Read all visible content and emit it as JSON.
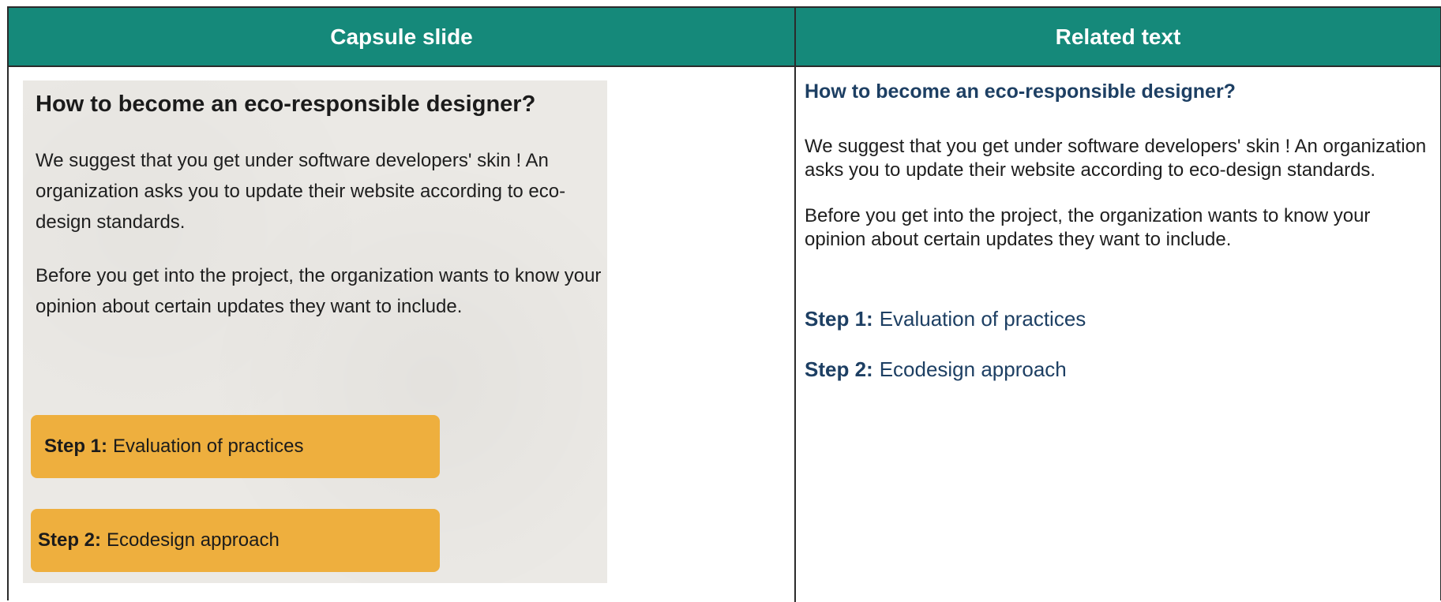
{
  "header": {
    "left_label": "Capsule slide",
    "right_label": "Related text"
  },
  "slide": {
    "title": "How to become an eco-responsible designer?",
    "paragraph1": "We suggest that you get under software developers' skin ! An organization asks you to update their website according to eco-design standards.",
    "paragraph2": "Before you get into the project, the organization wants to know your opinion about certain updates they want to include.",
    "steps": [
      {
        "label": "Step 1:",
        "text": "Evaluation of practices"
      },
      {
        "label": "Step 2:",
        "text": "Ecodesign approach"
      }
    ],
    "colors": {
      "background": "#ebe9e5",
      "step_box": "#eeaf3e"
    }
  },
  "related": {
    "title": "How to become an eco-responsible designer?",
    "paragraph1": "We suggest that you get under software developers' skin ! An organization asks you to update their website according to eco-design standards.",
    "paragraph2": "Before you get into the project, the organization wants to know your opinion about certain updates they want to include.",
    "steps": [
      {
        "label": "Step 1:",
        "text": "Evaluation of practices"
      },
      {
        "label": "Step 2:",
        "text": "Ecodesign approach"
      }
    ],
    "colors": {
      "heading": "#1d3f63"
    }
  },
  "colors": {
    "header_bg": "#15897a",
    "header_text": "#ffffff",
    "border": "#2b2b2b"
  }
}
